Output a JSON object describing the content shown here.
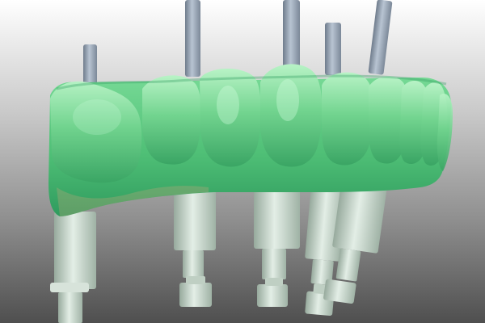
{
  "viewport": {
    "kind": "3d-dental-cad-render",
    "background": {
      "top": "#ffffff",
      "mid": "#c9c9c9",
      "bottom": "#4f4f4f"
    }
  },
  "scene": {
    "subject": "full-arch-implant-bridge-model",
    "colors": {
      "bridge_base": "#5ecb84",
      "bridge_highlight": "#a9f0b8",
      "bridge_shadow": "#2f9b5e",
      "gingiva_tint": "#c9a77a",
      "analog_body": "#d9e6dc",
      "analog_shadow": "#9fb2a5",
      "post_metal": "#a9b6c6",
      "post_shadow": "#6f7c8c"
    },
    "tooth_count": 9,
    "implant_post_count": 5,
    "lab_analog_count": 5
  }
}
